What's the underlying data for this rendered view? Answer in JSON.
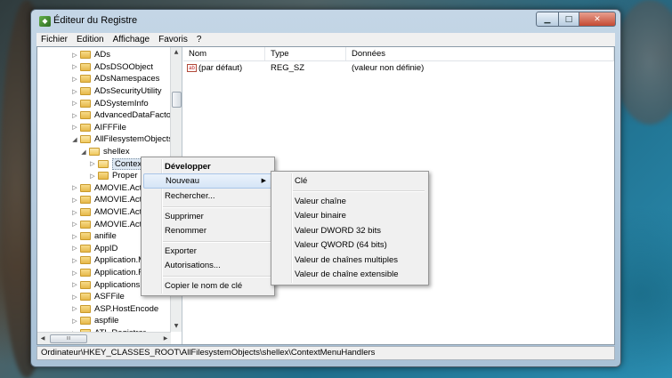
{
  "window": {
    "title": "Éditeur du Registre"
  },
  "menubar": [
    "Fichier",
    "Edition",
    "Affichage",
    "Favoris",
    "?"
  ],
  "tree": {
    "items": [
      {
        "label": "ADs",
        "expander": "▷"
      },
      {
        "label": "ADsDSOObject",
        "expander": "▷"
      },
      {
        "label": "ADsNamespaces",
        "expander": "▷"
      },
      {
        "label": "ADsSecurityUtility",
        "expander": "▷"
      },
      {
        "label": "ADSystemInfo",
        "expander": "▷"
      },
      {
        "label": "AdvancedDataFactory",
        "expander": "▷"
      },
      {
        "label": "AIFFFile",
        "expander": "▷"
      },
      {
        "label": "AllFilesystemObjects",
        "expander": "◢"
      },
      {
        "label": "shellex",
        "expander": "◢"
      },
      {
        "label": "Contex",
        "expander": "▷"
      },
      {
        "label": "Proper",
        "expander": "▷"
      },
      {
        "label": "AMOVIE.Activ",
        "expander": "▷"
      },
      {
        "label": "AMOVIE.Activ",
        "expander": "▷"
      },
      {
        "label": "AMOVIE.Activ",
        "expander": "▷"
      },
      {
        "label": "AMOVIE.Activ",
        "expander": "▷"
      },
      {
        "label": "anifile",
        "expander": "▷"
      },
      {
        "label": "AppID",
        "expander": "▷"
      },
      {
        "label": "Application.M",
        "expander": "▷"
      },
      {
        "label": "Application.R",
        "expander": "▷"
      },
      {
        "label": "Applications",
        "expander": "▷"
      },
      {
        "label": "ASFFile",
        "expander": "▷"
      },
      {
        "label": "ASP.HostEncode",
        "expander": "▷"
      },
      {
        "label": "aspfile",
        "expander": "▷"
      },
      {
        "label": "ATL.Registrar",
        "expander": "▷"
      }
    ]
  },
  "list": {
    "headers": {
      "nom": "Nom",
      "type": "Type",
      "donnees": "Données"
    },
    "rows": [
      {
        "icon": "ab",
        "nom": "(par défaut)",
        "type": "REG_SZ",
        "donnees": "(valeur non définie)"
      }
    ]
  },
  "context_menu": {
    "items": [
      "Développer",
      "Nouveau",
      "Rechercher...",
      "Supprimer",
      "Renommer",
      "Exporter",
      "Autorisations...",
      "Copier le nom de clé"
    ]
  },
  "submenu": {
    "items": [
      "Clé",
      "Valeur chaîne",
      "Valeur binaire",
      "Valeur DWORD 32 bits",
      "Valeur QWORD (64 bits)",
      "Valeur de chaînes multiples",
      "Valeur de chaîne extensible"
    ]
  },
  "statusbar": {
    "path": "Ordinateur\\HKEY_CLASSES_ROOT\\AllFilesystemObjects\\shellex\\ContextMenuHandlers"
  },
  "colors": {
    "menu_highlight": "#d6e5f6",
    "folder": "#e6b94a",
    "close_button": "#c44a32"
  },
  "icons": {
    "app": "registry-editor-icon",
    "minimize": "minimize-icon",
    "maximize": "maximize-icon",
    "close": "close-icon",
    "folder": "folder-icon",
    "string_value": "string-value-icon",
    "submenu": "chevron-right-icon"
  },
  "glyphs": {
    "minimize": "▁",
    "maximize": "□",
    "close": "✕",
    "submenu_arrow": "▶",
    "scroll_up": "▲",
    "scroll_down": "▼",
    "scroll_left": "◀",
    "scroll_right": "▶",
    "grip": "III"
  }
}
